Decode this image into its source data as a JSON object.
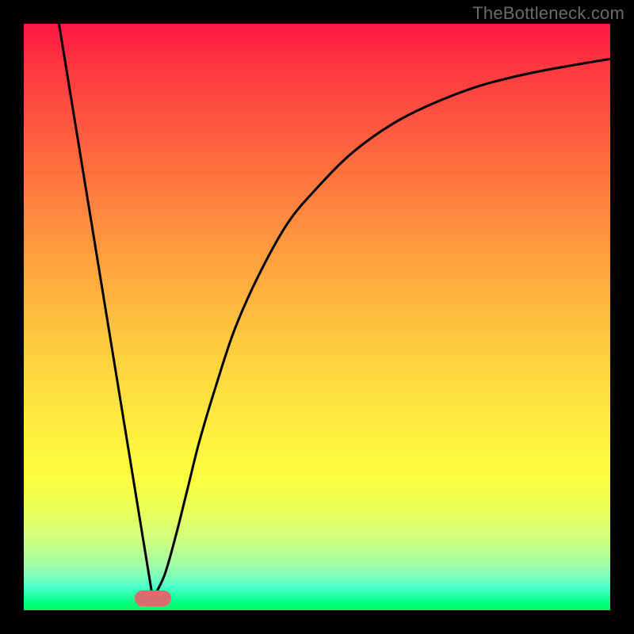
{
  "watermark": "TheBottleneck.com",
  "colors": {
    "curve_stroke": "#000000",
    "curve_width": 3,
    "marker_fill": "#db6b6e"
  },
  "chart_data": {
    "type": "line",
    "title": "",
    "xlabel": "",
    "ylabel": "",
    "xlim": [
      0,
      100
    ],
    "ylim": [
      0,
      100
    ],
    "curve": {
      "descent": {
        "x_start": 6,
        "y_start": 100,
        "x_end": 22,
        "y_end": 2
      },
      "ascent_samples": [
        {
          "x": 22,
          "y": 2
        },
        {
          "x": 24,
          "y": 6
        },
        {
          "x": 26,
          "y": 13
        },
        {
          "x": 28,
          "y": 21
        },
        {
          "x": 30,
          "y": 29
        },
        {
          "x": 33,
          "y": 39
        },
        {
          "x": 36,
          "y": 48
        },
        {
          "x": 40,
          "y": 57
        },
        {
          "x": 45,
          "y": 66
        },
        {
          "x": 50,
          "y": 72
        },
        {
          "x": 56,
          "y": 78
        },
        {
          "x": 63,
          "y": 83
        },
        {
          "x": 70,
          "y": 86.5
        },
        {
          "x": 78,
          "y": 89.5
        },
        {
          "x": 86,
          "y": 91.5
        },
        {
          "x": 94,
          "y": 93
        },
        {
          "x": 100,
          "y": 94
        }
      ]
    },
    "marker": {
      "x": 22,
      "y": 2,
      "width_pct": 6.2,
      "height_pct": 2.7
    }
  }
}
